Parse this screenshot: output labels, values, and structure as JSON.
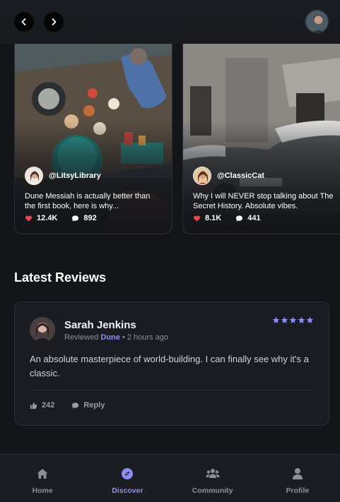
{
  "carousel": {
    "cards": [
      {
        "handle": "@LitsyLibrary",
        "text_line1": "Dune Messiah is actually better than",
        "text_line2": "the first book, here is why...",
        "likes": "12.4K",
        "comments": "892",
        "image": "market-boat-photo"
      },
      {
        "handle": "@ClassicCat",
        "text_line1": "Why I will NEVER stop talking about The",
        "text_line2": "Secret History. Absolute vibes.",
        "likes": "8.1K",
        "comments": "441",
        "image": "snowy-car-photo"
      }
    ]
  },
  "section": {
    "title": "Latest Reviews"
  },
  "review": {
    "name": "Sarah Jenkins",
    "prefix": "Reviewed",
    "book": "Dune",
    "time": "• 2 hours ago",
    "rating": 5,
    "body": "An absolute masterpiece of world-building. I can finally see why it's a classic.",
    "likes": "242",
    "reply_label": "Reply"
  },
  "bottom_nav": {
    "tabs": [
      {
        "label": "Home",
        "icon": "home-icon",
        "active": false
      },
      {
        "label": "Discover",
        "icon": "compass-icon",
        "active": true
      },
      {
        "label": "Community",
        "icon": "users-icon",
        "active": false
      },
      {
        "label": "Profile",
        "icon": "user-icon",
        "active": false
      }
    ]
  },
  "colors": {
    "accent": "#8b8ff4",
    "heart": "#e5484d",
    "background": "#141519",
    "card": "#1b1c21"
  }
}
